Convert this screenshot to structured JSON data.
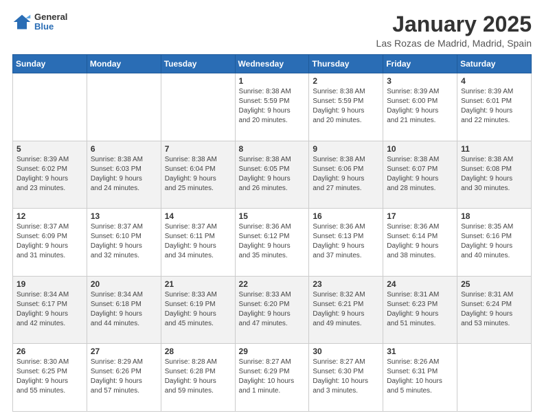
{
  "header": {
    "logo": {
      "general": "General",
      "blue": "Blue"
    },
    "title": "January 2025",
    "location": "Las Rozas de Madrid, Madrid, Spain"
  },
  "weekdays": [
    "Sunday",
    "Monday",
    "Tuesday",
    "Wednesday",
    "Thursday",
    "Friday",
    "Saturday"
  ],
  "weeks": [
    [
      {
        "day": "",
        "info": ""
      },
      {
        "day": "",
        "info": ""
      },
      {
        "day": "",
        "info": ""
      },
      {
        "day": "1",
        "info": "Sunrise: 8:38 AM\nSunset: 5:59 PM\nDaylight: 9 hours\nand 20 minutes."
      },
      {
        "day": "2",
        "info": "Sunrise: 8:38 AM\nSunset: 5:59 PM\nDaylight: 9 hours\nand 20 minutes."
      },
      {
        "day": "3",
        "info": "Sunrise: 8:39 AM\nSunset: 6:00 PM\nDaylight: 9 hours\nand 21 minutes."
      },
      {
        "day": "4",
        "info": "Sunrise: 8:39 AM\nSunset: 6:01 PM\nDaylight: 9 hours\nand 22 minutes."
      }
    ],
    [
      {
        "day": "5",
        "info": "Sunrise: 8:39 AM\nSunset: 6:02 PM\nDaylight: 9 hours\nand 23 minutes."
      },
      {
        "day": "6",
        "info": "Sunrise: 8:38 AM\nSunset: 6:03 PM\nDaylight: 9 hours\nand 24 minutes."
      },
      {
        "day": "7",
        "info": "Sunrise: 8:38 AM\nSunset: 6:04 PM\nDaylight: 9 hours\nand 25 minutes."
      },
      {
        "day": "8",
        "info": "Sunrise: 8:38 AM\nSunset: 6:05 PM\nDaylight: 9 hours\nand 26 minutes."
      },
      {
        "day": "9",
        "info": "Sunrise: 8:38 AM\nSunset: 6:06 PM\nDaylight: 9 hours\nand 27 minutes."
      },
      {
        "day": "10",
        "info": "Sunrise: 8:38 AM\nSunset: 6:07 PM\nDaylight: 9 hours\nand 28 minutes."
      },
      {
        "day": "11",
        "info": "Sunrise: 8:38 AM\nSunset: 6:08 PM\nDaylight: 9 hours\nand 30 minutes."
      }
    ],
    [
      {
        "day": "12",
        "info": "Sunrise: 8:37 AM\nSunset: 6:09 PM\nDaylight: 9 hours\nand 31 minutes."
      },
      {
        "day": "13",
        "info": "Sunrise: 8:37 AM\nSunset: 6:10 PM\nDaylight: 9 hours\nand 32 minutes."
      },
      {
        "day": "14",
        "info": "Sunrise: 8:37 AM\nSunset: 6:11 PM\nDaylight: 9 hours\nand 34 minutes."
      },
      {
        "day": "15",
        "info": "Sunrise: 8:36 AM\nSunset: 6:12 PM\nDaylight: 9 hours\nand 35 minutes."
      },
      {
        "day": "16",
        "info": "Sunrise: 8:36 AM\nSunset: 6:13 PM\nDaylight: 9 hours\nand 37 minutes."
      },
      {
        "day": "17",
        "info": "Sunrise: 8:36 AM\nSunset: 6:14 PM\nDaylight: 9 hours\nand 38 minutes."
      },
      {
        "day": "18",
        "info": "Sunrise: 8:35 AM\nSunset: 6:16 PM\nDaylight: 9 hours\nand 40 minutes."
      }
    ],
    [
      {
        "day": "19",
        "info": "Sunrise: 8:34 AM\nSunset: 6:17 PM\nDaylight: 9 hours\nand 42 minutes."
      },
      {
        "day": "20",
        "info": "Sunrise: 8:34 AM\nSunset: 6:18 PM\nDaylight: 9 hours\nand 44 minutes."
      },
      {
        "day": "21",
        "info": "Sunrise: 8:33 AM\nSunset: 6:19 PM\nDaylight: 9 hours\nand 45 minutes."
      },
      {
        "day": "22",
        "info": "Sunrise: 8:33 AM\nSunset: 6:20 PM\nDaylight: 9 hours\nand 47 minutes."
      },
      {
        "day": "23",
        "info": "Sunrise: 8:32 AM\nSunset: 6:21 PM\nDaylight: 9 hours\nand 49 minutes."
      },
      {
        "day": "24",
        "info": "Sunrise: 8:31 AM\nSunset: 6:23 PM\nDaylight: 9 hours\nand 51 minutes."
      },
      {
        "day": "25",
        "info": "Sunrise: 8:31 AM\nSunset: 6:24 PM\nDaylight: 9 hours\nand 53 minutes."
      }
    ],
    [
      {
        "day": "26",
        "info": "Sunrise: 8:30 AM\nSunset: 6:25 PM\nDaylight: 9 hours\nand 55 minutes."
      },
      {
        "day": "27",
        "info": "Sunrise: 8:29 AM\nSunset: 6:26 PM\nDaylight: 9 hours\nand 57 minutes."
      },
      {
        "day": "28",
        "info": "Sunrise: 8:28 AM\nSunset: 6:28 PM\nDaylight: 9 hours\nand 59 minutes."
      },
      {
        "day": "29",
        "info": "Sunrise: 8:27 AM\nSunset: 6:29 PM\nDaylight: 10 hours\nand 1 minute."
      },
      {
        "day": "30",
        "info": "Sunrise: 8:27 AM\nSunset: 6:30 PM\nDaylight: 10 hours\nand 3 minutes."
      },
      {
        "day": "31",
        "info": "Sunrise: 8:26 AM\nSunset: 6:31 PM\nDaylight: 10 hours\nand 5 minutes."
      },
      {
        "day": "",
        "info": ""
      }
    ]
  ]
}
